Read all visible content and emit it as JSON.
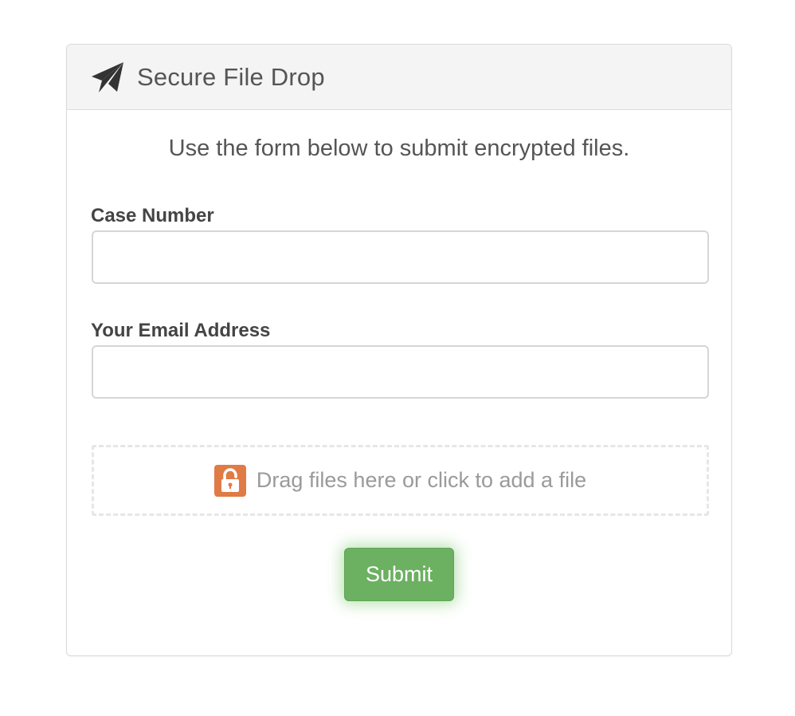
{
  "panel": {
    "title": "Secure File Drop",
    "header_icon": "paper-plane-icon"
  },
  "intro": "Use the form below to submit encrypted files.",
  "form": {
    "case_number": {
      "label": "Case Number",
      "value": "",
      "placeholder": ""
    },
    "email": {
      "label": "Your Email Address",
      "value": "",
      "placeholder": ""
    },
    "dropzone": {
      "text": "Drag files here or click to add a file",
      "icon": "lock-icon"
    },
    "submit_label": "Submit"
  },
  "colors": {
    "submit": "#6cb061",
    "lock": "#e07b45",
    "header_bg": "#f4f4f4"
  }
}
